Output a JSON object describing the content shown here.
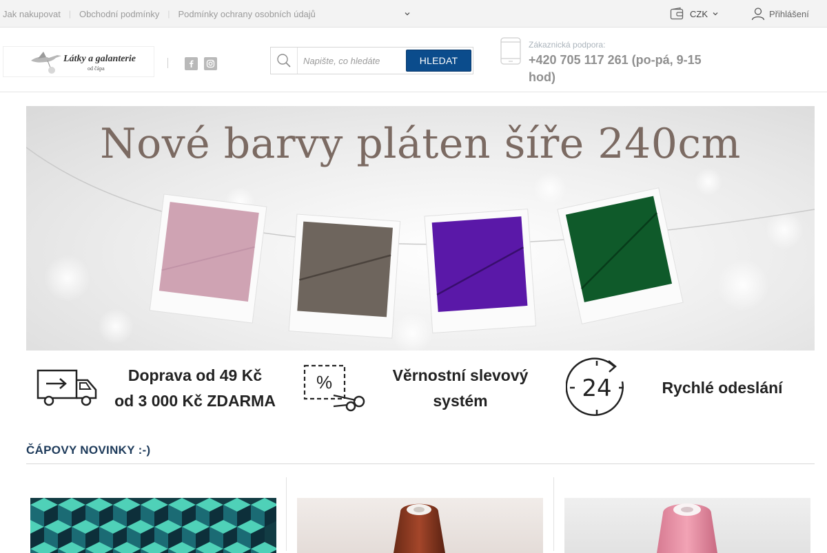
{
  "topbar": {
    "links": [
      "Jak nakupovat",
      "Obchodní podmínky",
      "Podmínky ochrany osobních údajů"
    ],
    "currency": "CZK",
    "login": "Přihlášení"
  },
  "header": {
    "logo_name": "Látky a galanterie",
    "logo_sub": "od čápa",
    "search_placeholder": "Napište, co hledáte",
    "search_button": "HLEDAT",
    "support_label": "Zákaznická podpora:",
    "support_phone": "+420 705 117 261 (po-pá, 9-15 hod)"
  },
  "banner": {
    "title": "Nové barvy pláten šíře 240cm",
    "swatch_colors": [
      "#cfa3b3",
      "#6e655d",
      "#5a18a8",
      "#0f5a2a"
    ]
  },
  "benefits": {
    "shipping_line1": "Doprava od 49 Kč",
    "shipping_line2": "od 3 000 Kč ZDARMA",
    "loyalty_line1": "Věrnostní slevový",
    "loyalty_line2": "systém",
    "fast_badge": "24",
    "fast": "Rychlé odeslání"
  },
  "section": {
    "title": "ČÁPOVY NOVINKY :-)"
  },
  "products": [
    {
      "image": "teal-cubes-fabric"
    },
    {
      "image": "brown-thread-spool"
    },
    {
      "image": "pink-thread-spool"
    }
  ]
}
